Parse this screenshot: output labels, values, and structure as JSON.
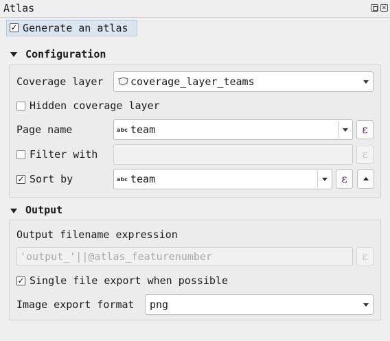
{
  "window": {
    "title": "Atlas"
  },
  "generate": {
    "label": "Generate an atlas",
    "checked": true
  },
  "configuration": {
    "header": "Configuration",
    "coverage_layer_label": "Coverage layer",
    "coverage_layer_value": "coverage_layer_teams",
    "hidden_coverage_label": "Hidden coverage layer",
    "hidden_coverage_checked": false,
    "page_name_label": "Page name",
    "page_name_value": "team",
    "page_name_type": "abc",
    "filter_with_label": "Filter with",
    "filter_with_checked": false,
    "filter_value": "",
    "sort_by_label": "Sort by",
    "sort_by_checked": true,
    "sort_by_value": "team",
    "sort_by_type": "abc"
  },
  "output": {
    "header": "Output",
    "filename_label": "Output filename expression",
    "filename_value": "'output_'||@atlas_featurenumber",
    "single_file_label": "Single file export when possible",
    "single_file_checked": true,
    "image_format_label": "Image export format",
    "image_format_value": "png"
  },
  "icons": {
    "expression": "ε",
    "check": "✓"
  }
}
